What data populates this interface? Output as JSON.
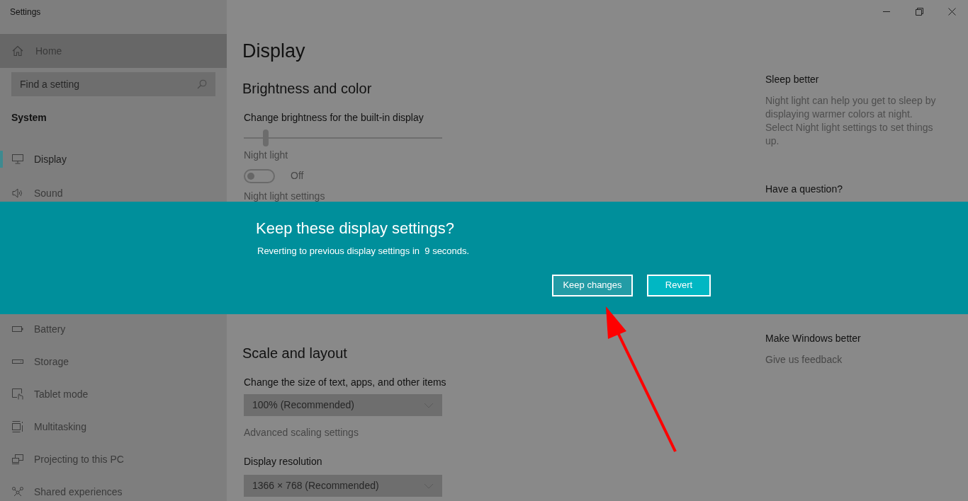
{
  "window": {
    "title": "Settings"
  },
  "sidebar": {
    "home": {
      "label": "Home",
      "selected": true
    },
    "search": {
      "placeholder": "Find a setting"
    },
    "section": "System",
    "items_top": [
      {
        "label": "Display",
        "selected": true
      },
      {
        "label": "Sound",
        "selected": false
      }
    ],
    "items_bottom": [
      {
        "label": "Battery",
        "selected": false
      },
      {
        "label": "Storage",
        "selected": false
      },
      {
        "label": "Tablet mode",
        "selected": false
      },
      {
        "label": "Multitasking",
        "selected": false
      },
      {
        "label": "Projecting to this PC",
        "selected": false
      },
      {
        "label": "Shared experiences",
        "selected": false
      }
    ]
  },
  "main": {
    "title": "Display",
    "brightness": {
      "heading": "Brightness and color",
      "label": "Change brightness for the built-in display",
      "level": 0.11
    },
    "night_light": {
      "label": "Night light",
      "on": false,
      "state": "Off",
      "settings_link": "Night light settings"
    },
    "scale": {
      "heading": "Scale and layout",
      "label": "Change the size of text, apps, and other items",
      "dropdown": "100% (Recommended)",
      "link": "Advanced scaling settings"
    },
    "resolution": {
      "label": "Display resolution",
      "dropdown": "1366 × 768 (Recommended)"
    }
  },
  "aside": {
    "sleep_heading": "Sleep better",
    "sleep_text": "Night light can help you get to sleep by displaying warmer colors at night. Select Night light settings to set things up.",
    "question_heading": "Have a question?",
    "feedback_heading": "Make Windows better",
    "feedback_link": "Give us feedback"
  },
  "dialog": {
    "title": "Keep these display settings?",
    "message": "Reverting to previous display settings in  9 seconds.",
    "buttons": [
      {
        "label": "Keep changes",
        "kind": "secondary"
      },
      {
        "label": "Revert",
        "kind": "primary"
      }
    ]
  }
}
